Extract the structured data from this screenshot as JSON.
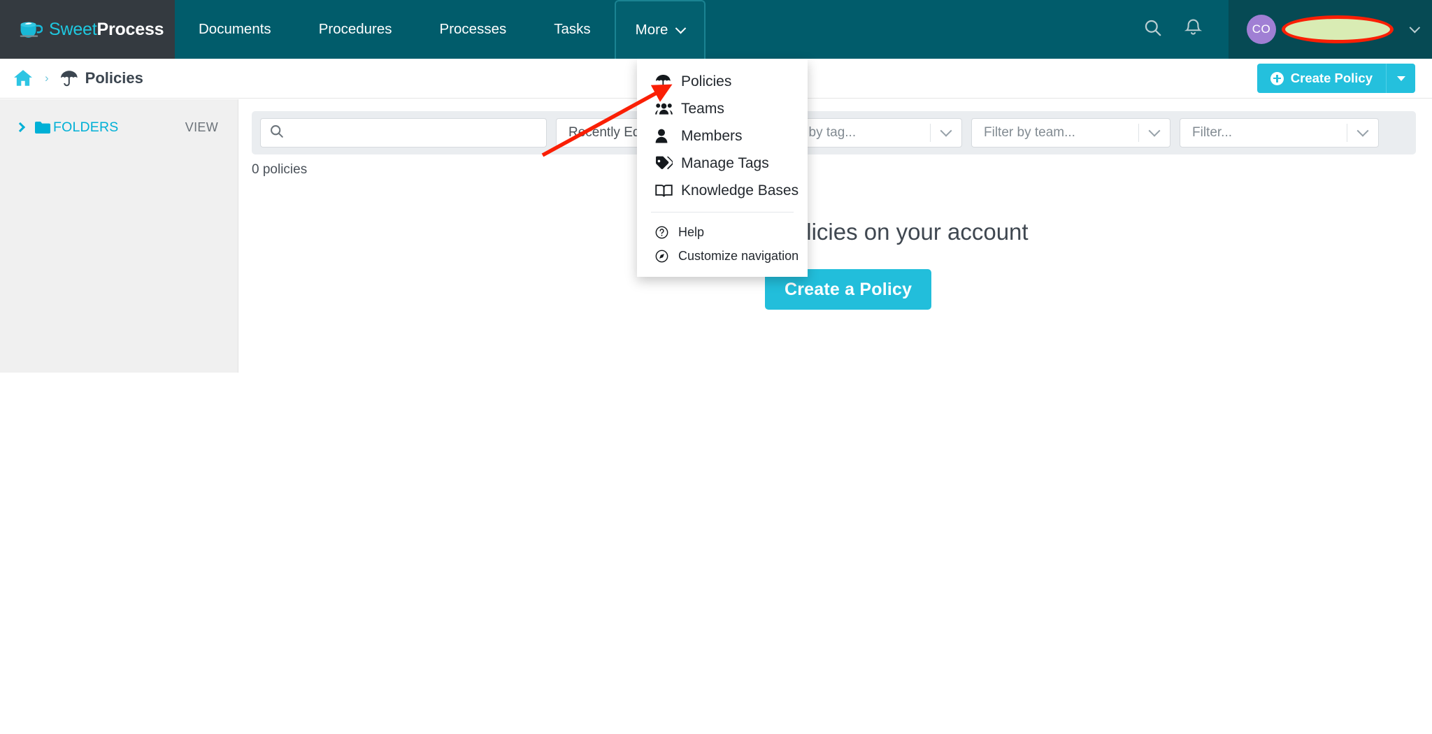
{
  "brand": {
    "name_light": "Sweet",
    "name_bold": "Process",
    "logo_icon": "coffee-cup-icon",
    "accent_cyan": "#1fc8e0",
    "navbar_bg": "#015c6b",
    "logo_bg": "#343a40"
  },
  "navbar": {
    "items": [
      {
        "label": "Documents",
        "active": false
      },
      {
        "label": "Procedures",
        "active": false
      },
      {
        "label": "Processes",
        "active": false
      },
      {
        "label": "Tasks",
        "active": false
      },
      {
        "label": "More",
        "active": true
      }
    ],
    "search_icon": "search-icon",
    "notifications_icon": "bell-icon",
    "account": {
      "avatar_initials": "CO",
      "avatar_color": "#a07fd4",
      "name_redacted": true,
      "redaction_fill": "#d9ecb4",
      "redaction_stroke": "#fa1f05",
      "chevron_icon": "chevron-down-icon"
    }
  },
  "breadcrumb": {
    "home_icon": "home-icon",
    "separator": "›",
    "page_icon": "umbrella-icon",
    "title": "Policies"
  },
  "toolbar": {
    "create_label": "Create Policy",
    "create_icon": "plus-circle-icon",
    "create_caret_icon": "caret-down-icon",
    "create_color": "#24c0dd"
  },
  "sidebar": {
    "chevron_icon": "chevron-right-icon",
    "folder_icon": "folder-icon",
    "folders_label": "FOLDERS",
    "view_label": "VIEW"
  },
  "filters": {
    "search": {
      "value": "",
      "placeholder": "",
      "icon": "search-icon"
    },
    "sort": {
      "value": "Recently Edited"
    },
    "tag": {
      "value": "Filter by tag..."
    },
    "team": {
      "value": "Filter by team..."
    },
    "other": {
      "value": "Filter..."
    },
    "chevron_icon": "chevron-down-icon"
  },
  "main": {
    "count_label": "0 policies",
    "empty_heading": "There are no policies on your account",
    "empty_cta_label": "Create a Policy",
    "empty_cta_color": "#22bedb"
  },
  "dropdown": {
    "items": [
      {
        "label": "Policies",
        "icon": "umbrella-icon"
      },
      {
        "label": "Teams",
        "icon": "users-icon"
      },
      {
        "label": "Members",
        "icon": "user-icon"
      },
      {
        "label": "Manage Tags",
        "icon": "tags-icon"
      },
      {
        "label": "Knowledge Bases",
        "icon": "book-open-icon"
      }
    ],
    "secondary_items": [
      {
        "label": "Help",
        "icon": "question-circle-icon"
      },
      {
        "label": "Customize navigation",
        "icon": "compass-icon"
      }
    ]
  },
  "annotation": {
    "arrow_color": "#fa1f05",
    "points_to": "Policies"
  }
}
